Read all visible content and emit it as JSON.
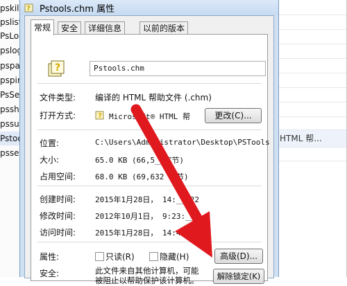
{
  "background": {
    "list_items": [
      "pskill",
      "pslist",
      "PsLog",
      "pslog",
      "pspa",
      "pspin",
      "PsSer",
      "pssh",
      "pssus",
      "Pstoo",
      "psser"
    ],
    "right_text": "HTML 帮..."
  },
  "dialog": {
    "title": "Pstools.chm 属性",
    "tabs": [
      "常规",
      "安全",
      "详细信息",
      "以前的版本"
    ],
    "file_name": "Pstools.chm",
    "rows": {
      "type_label": "文件类型:",
      "type_value": "编译的 HTML 帮助文件 (.chm)",
      "open_label": "打开方式:",
      "open_value": "Microsoft® HTML 帮",
      "change_btn": "更改(C)...",
      "loc_label": "位置:",
      "loc_value": "C:\\Users\\Administrator\\Desktop\\PSTools",
      "size_label": "大小:",
      "size_value": "65.0 KB (66,5__字节)",
      "disk_label": "占用空间:",
      "disk_value": "68.0 KB (69,632 字节)",
      "created_label": "创建时间:",
      "created_value": "2015年1月28日， 14:__:22",
      "modified_label": "修改时间:",
      "modified_value": "2012年10月1日， 9:23:__",
      "accessed_label": "访问时间:",
      "accessed_value": "2015年1月28日， 14:42:__",
      "attr_label": "属性:",
      "readonly": "只读(R)",
      "hidden": "隐藏(H)",
      "advanced_btn": "高级(D)...",
      "security_label": "安全:",
      "security_text1": "此文件来自其他计算机，可能",
      "security_text2": "被阻止以帮助保护该计算机。",
      "unblock_btn": "解除锁定(K)"
    }
  },
  "colors": {
    "arrow": "#e0191f",
    "title_bg": "#cfe0f3"
  },
  "icons": {
    "title_icon": "chm-file-icon",
    "file_icon": "chm-file-icon",
    "app_icon": "help-app-icon"
  }
}
